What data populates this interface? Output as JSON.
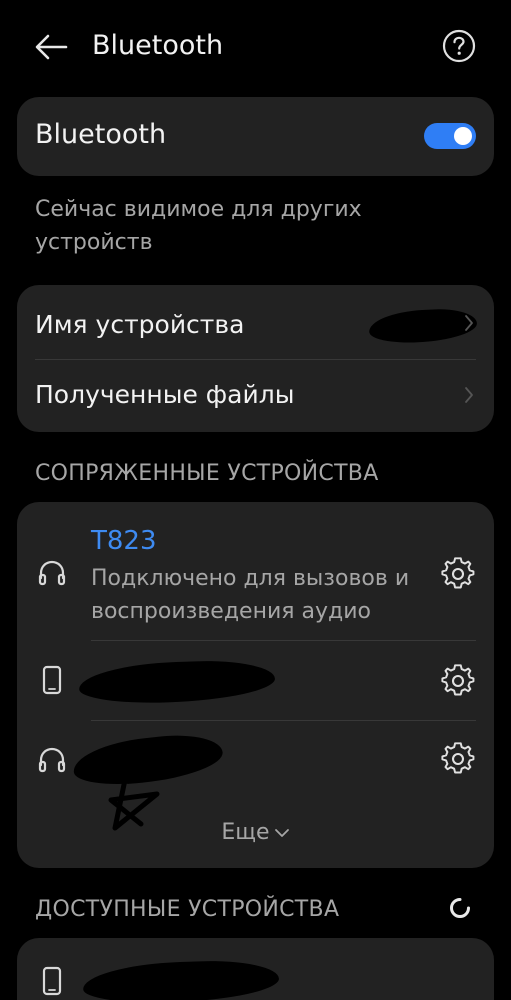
{
  "header": {
    "title": "Bluetooth",
    "back_icon": "arrow-left-icon",
    "help_icon": "question-circle-icon"
  },
  "bluetooth_toggle": {
    "label": "Bluetooth",
    "enabled": true,
    "accent_color": "#2f7ef5"
  },
  "visibility_text": "Сейчас видимое для других устройств",
  "settings": {
    "device_name_label": "Имя устройства",
    "device_name_value_redacted": true,
    "received_files_label": "Полученные файлы"
  },
  "paired": {
    "header": "СОПРЯЖЕННЫЕ УСТРОЙСТВА",
    "devices": [
      {
        "name": "T823",
        "status": "Подключено для вызовов и воспроизведения аудио",
        "icon": "headphones-icon",
        "connected": true,
        "name_color": "#3e8bf2"
      },
      {
        "name": "",
        "icon": "phone-icon",
        "redacted": true
      },
      {
        "name": "",
        "icon": "headphones-icon",
        "redacted": true
      }
    ],
    "more_label": "Еще"
  },
  "available": {
    "header": "ДОСТУПНЫЕ УСТРОЙСТВА",
    "scanning_icon": "loading-spinner-icon",
    "devices": [
      {
        "name": "",
        "icon": "phone-icon",
        "redacted": true
      }
    ]
  }
}
